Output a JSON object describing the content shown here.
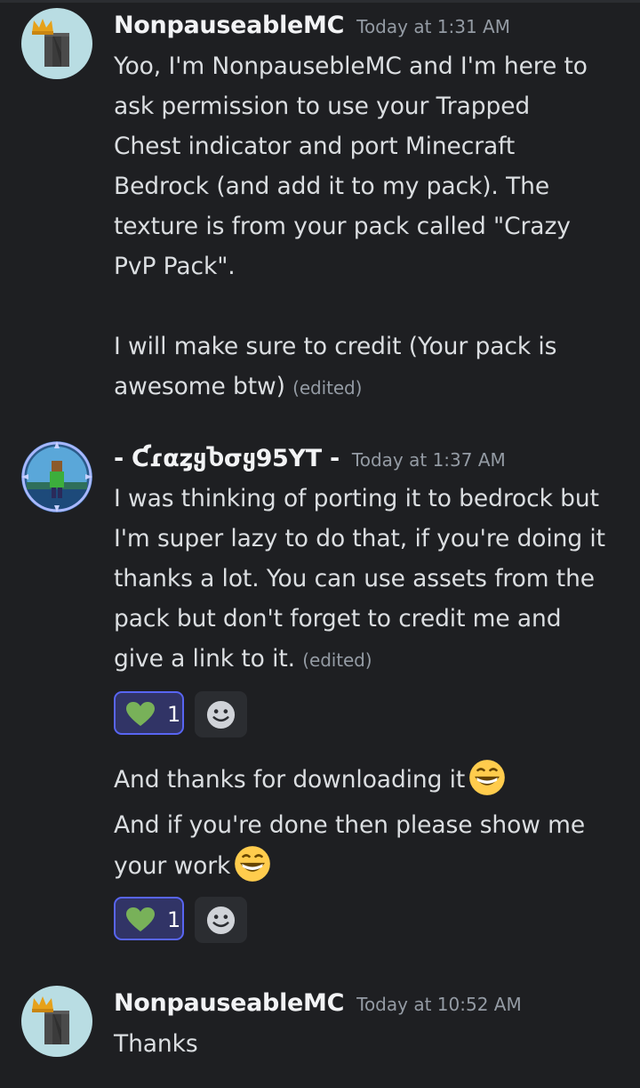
{
  "messages": [
    {
      "author": "NonpauseableMC",
      "timestamp": "Today at 1:31 AM",
      "lines": [
        "Yoo, I'm NonpausebleMC and I'm here to",
        "ask permission to use your Trapped",
        "Chest indicator and port Minecraft",
        "Bedrock (and add it to my pack). The",
        "texture is from your pack called \"Crazy",
        "PvP Pack\".",
        "",
        "I will make sure to credit (Your pack is",
        "awesome btw)"
      ],
      "edited": "(edited)"
    },
    {
      "author": "- ƇɾαȥყႦσყ95YT -",
      "timestamp": "Today at 1:37 AM",
      "lines": [
        "I was thinking of porting it to bedrock but",
        "I'm super lazy to do that, if you're doing it",
        "thanks a lot. You can use assets from the",
        "pack but don't forget to credit me and",
        "give a link to it."
      ],
      "edited": "(edited)",
      "reaction": {
        "emoji": "green-heart",
        "count": "1"
      },
      "followups": [
        {
          "lines": [
            "And thanks for downloading it"
          ],
          "emoji": "grin"
        },
        {
          "lines": [
            "And if you're done then please show me",
            "your work"
          ],
          "emoji": "grin"
        }
      ],
      "reaction2": {
        "emoji": "green-heart",
        "count": "1"
      }
    },
    {
      "author": "NonpauseableMC",
      "timestamp": "Today at 10:52 AM",
      "lines": [
        "Thanks"
      ]
    }
  ],
  "colors": {
    "background": "#1e1f22",
    "text": "#dbdee1",
    "muted": "#949ba4",
    "reaction_border": "#5865f2",
    "reaction_bg": "#313466",
    "heart": "#78b159"
  }
}
